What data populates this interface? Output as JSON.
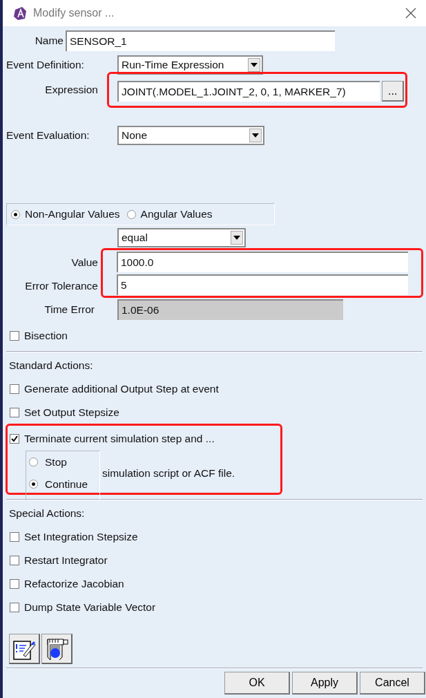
{
  "window": {
    "title": "Modify sensor ..."
  },
  "name": {
    "label": "Name",
    "value": "SENSOR_1"
  },
  "event_definition": {
    "label": "Event Definition:",
    "value": "Run-Time Expression"
  },
  "expression": {
    "label": "Expression",
    "value": "JOINT(.MODEL_1.JOINT_2, 0, 1, MARKER_7)",
    "button": "...",
    "highlighted": true
  },
  "event_evaluation": {
    "label": "Event Evaluation:",
    "value": "None"
  },
  "value_type": [
    {
      "label": "Non-Angular Values",
      "selected": true
    },
    {
      "label": "Angular Values",
      "selected": false
    }
  ],
  "comparison": {
    "value": "equal"
  },
  "value_fields": {
    "highlighted": true,
    "fields": [
      {
        "label": "Value",
        "value": "1000.0"
      },
      {
        "label": "Error Tolerance",
        "value": "5"
      }
    ]
  },
  "time_error": {
    "label": "Time Error",
    "value": "1.0E-06",
    "disabled": true
  },
  "bisection": {
    "label": "Bisection",
    "checked": false
  },
  "standard_actions": {
    "heading": "Standard Actions:",
    "items": [
      {
        "label": "Generate additional Output Step at event",
        "checked": false
      },
      {
        "label": "Set Output Stepsize",
        "checked": false
      },
      {
        "label": "Terminate current simulation step and ...",
        "checked": true,
        "highlighted": true,
        "options": [
          {
            "label": "Stop",
            "selected": false
          },
          {
            "label": "Continue",
            "selected": true
          }
        ],
        "note": "simulation script or ACF file."
      }
    ]
  },
  "special_actions": {
    "heading": "Special Actions:",
    "items": [
      {
        "label": "Set Integration Stepsize",
        "checked": false
      },
      {
        "label": "Restart Integrator",
        "checked": false
      },
      {
        "label": "Refactorize Jacobian",
        "checked": false
      },
      {
        "label": "Dump State Variable Vector",
        "checked": false
      }
    ]
  },
  "buttons": [
    "OK",
    "Apply",
    "Cancel"
  ]
}
